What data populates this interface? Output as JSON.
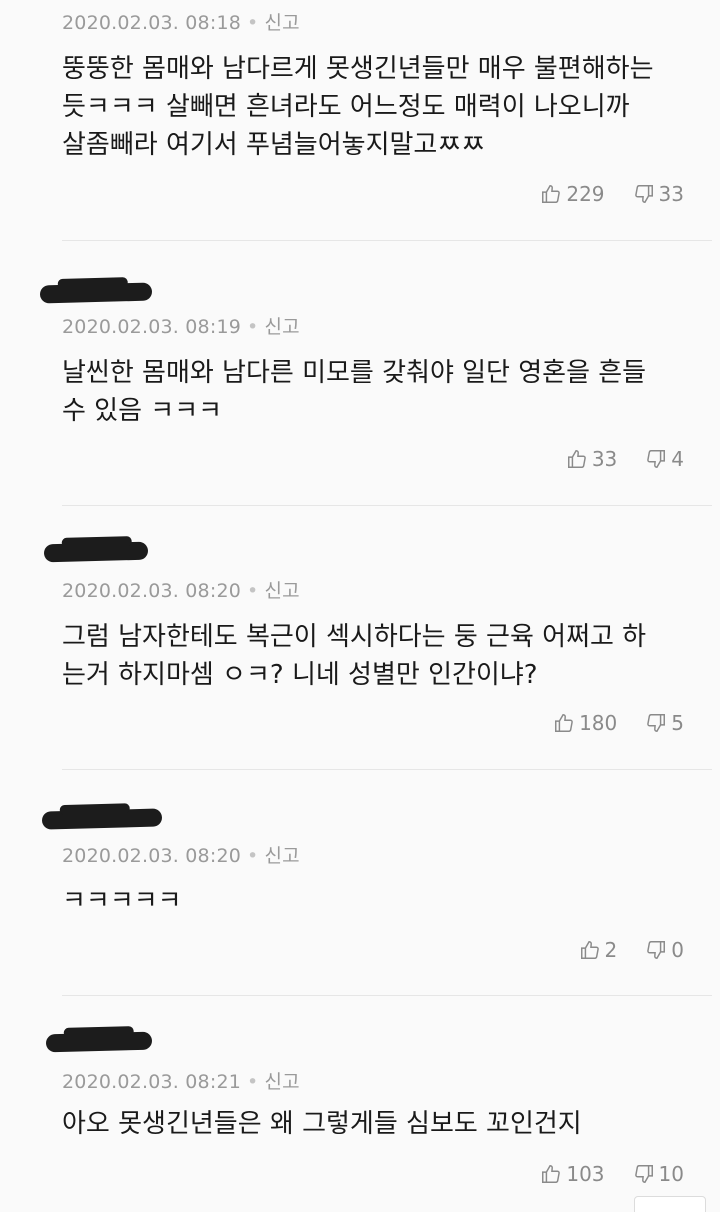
{
  "comments": [
    {
      "date": "2020.02.03. 08:18",
      "report": "신고",
      "lines": [
        "뚱뚱한 몸매와 남다르게 못생긴년들만 매우 불편해하는",
        "듯ㅋㅋㅋ 살빼면 흔녀라도 어느정도 매력이 나오니까",
        "살좀빼라 여기서 푸념늘어놓지말고ㅉㅉ"
      ],
      "likes": "229",
      "dislikes": "33"
    },
    {
      "date": "2020.02.03. 08:19",
      "report": "신고",
      "lines": [
        "날씬한 몸매와 남다른 미모를 갖춰야 일단 영혼을 흔들",
        "수 있음 ㅋㅋㅋ"
      ],
      "likes": "33",
      "dislikes": "4"
    },
    {
      "date": "2020.02.03. 08:20",
      "report": "신고",
      "lines": [
        "그럼 남자한테도 복근이 섹시하다는 둥 근육 어쩌고 하",
        "는거 하지마셈 ㅇㅋ? 니네 성별만 인간이냐?"
      ],
      "likes": "180",
      "dislikes": "5"
    },
    {
      "date": "2020.02.03. 08:20",
      "report": "신고",
      "lines": [
        "ㅋㅋㅋㅋㅋ"
      ],
      "likes": "2",
      "dislikes": "0"
    },
    {
      "date": "2020.02.03. 08:21",
      "report": "신고",
      "lines": [
        "아오 못생긴년들은 왜 그렇게들 심보도 꼬인건지"
      ],
      "likes": "103",
      "dislikes": "10"
    }
  ],
  "icons": {
    "like": "thumbs-up-icon",
    "dislike": "thumbs-down-icon"
  },
  "colors": {
    "background": "#fafafa",
    "meta_text": "#9a9a9a",
    "body_text": "#1a1a1a",
    "divider": "#e6e6e6"
  }
}
